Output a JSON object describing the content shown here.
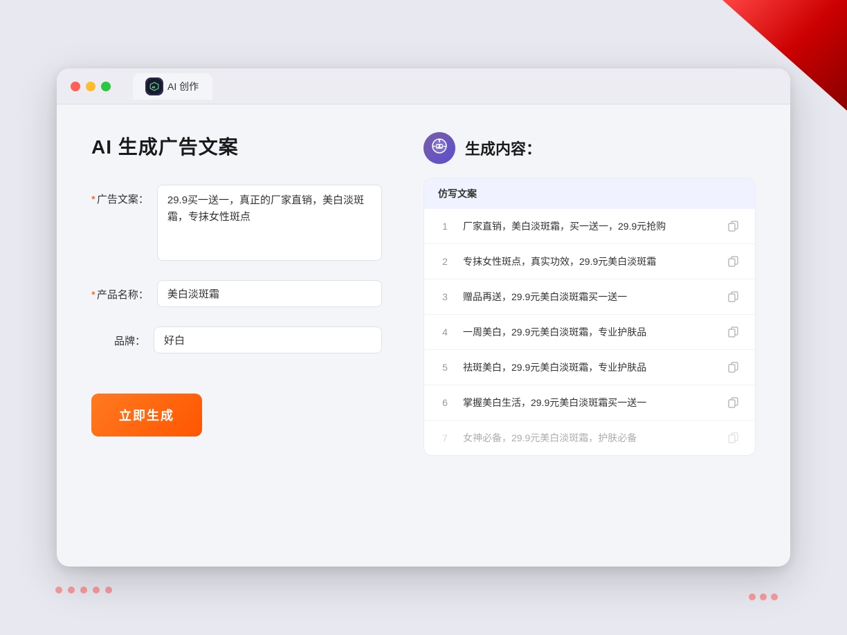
{
  "background": {
    "deco_label": "background decoration"
  },
  "browser": {
    "tab_label": "AI 创作",
    "ai_icon_text": "AI"
  },
  "left_panel": {
    "page_title": "AI 生成广告文案",
    "form": {
      "ad_copy_label": "广告文案：",
      "ad_copy_required": "*",
      "ad_copy_value": "29.9买一送一，真正的厂家直销，美白淡斑霜，专抹女性斑点",
      "product_name_label": "产品名称：",
      "product_name_required": "*",
      "product_name_value": "美白淡斑霜",
      "brand_label": "品牌：",
      "brand_value": "好白"
    },
    "generate_button": "立即生成"
  },
  "right_panel": {
    "bot_icon": "🤖",
    "title": "生成内容：",
    "results_header": "仿写文案",
    "results": [
      {
        "num": "1",
        "text": "厂家直销，美白淡斑霜，买一送一，29.9元抢购",
        "dimmed": false
      },
      {
        "num": "2",
        "text": "专抹女性斑点，真实功效，29.9元美白淡斑霜",
        "dimmed": false
      },
      {
        "num": "3",
        "text": "赠品再送，29.9元美白淡斑霜买一送一",
        "dimmed": false
      },
      {
        "num": "4",
        "text": "一周美白，29.9元美白淡斑霜，专业护肤品",
        "dimmed": false
      },
      {
        "num": "5",
        "text": "祛斑美白，29.9元美白淡斑霜，专业护肤品",
        "dimmed": false
      },
      {
        "num": "6",
        "text": "掌握美白生活，29.9元美白淡斑霜买一送一",
        "dimmed": false
      },
      {
        "num": "7",
        "text": "女神必备，29.9元美白淡斑霜，护肤必备",
        "dimmed": true
      }
    ]
  }
}
